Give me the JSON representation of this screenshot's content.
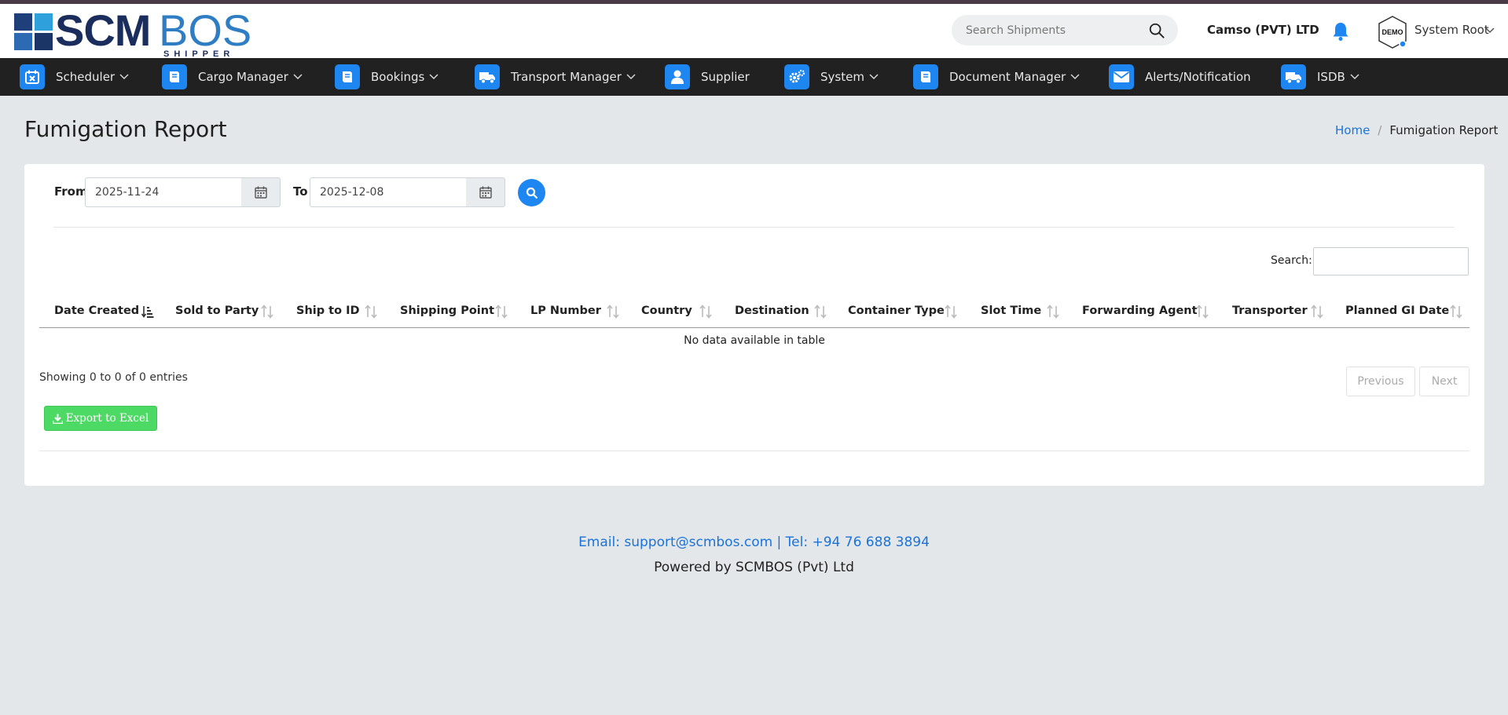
{
  "brand": {
    "logo_main": "SCM",
    "logo_accent": "BOS",
    "logo_sub": "SHIPPER"
  },
  "header": {
    "search_placeholder": "Search Shipments",
    "company": "Camso (PVT) LTD",
    "avatar_label": "DEMO",
    "user_name": "System Root"
  },
  "nav": {
    "items": [
      {
        "label": "Scheduler",
        "icon": "calendar-icon",
        "dropdown": true
      },
      {
        "label": "Cargo Manager",
        "icon": "book-icon",
        "dropdown": true
      },
      {
        "label": "Bookings",
        "icon": "book-icon",
        "dropdown": true
      },
      {
        "label": "Transport Manager",
        "icon": "truck-icon",
        "dropdown": true
      },
      {
        "label": "Supplier",
        "icon": "user-icon",
        "dropdown": false
      },
      {
        "label": "System",
        "icon": "cogs-icon",
        "dropdown": true
      },
      {
        "label": "Document Manager",
        "icon": "book-icon",
        "dropdown": true
      },
      {
        "label": "Alerts/Notification",
        "icon": "envelope-icon",
        "dropdown": false
      },
      {
        "label": "ISDB",
        "icon": "truck-icon",
        "dropdown": true
      }
    ]
  },
  "page": {
    "title": "Fumigation Report",
    "breadcrumb": {
      "home": "Home",
      "separator": "/",
      "current": "Fumigation Report"
    }
  },
  "filters": {
    "from_label": "From",
    "from_value": "2025-11-24",
    "to_label": "To",
    "to_value": "2025-12-08"
  },
  "table": {
    "search_label": "Search:",
    "columns": [
      "Date Created",
      "Sold to Party",
      "Ship to ID",
      "Shipping Point",
      "LP Number",
      "Country",
      "Destination",
      "Container Type",
      "Slot Time",
      "Forwarding Agent",
      "Transporter",
      "Planned GI Date"
    ],
    "empty_message": "No data available in table",
    "info": "Showing 0 to 0 of 0 entries",
    "prev_label": "Previous",
    "next_label": "Next",
    "export_label": "Export to Excel"
  },
  "footer": {
    "contact": "Email: support@scmbos.com | Tel: +94 76 688 3894",
    "powered": "Powered by SCMBOS (Pvt) Ltd"
  },
  "colors": {
    "accent": "#1e86f0",
    "nav_bg": "#212121",
    "export_green": "#4cd964",
    "page_bg": "#e4e7e9"
  }
}
